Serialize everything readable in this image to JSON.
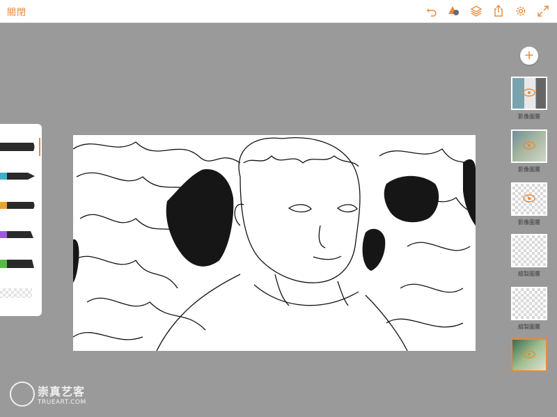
{
  "topbar": {
    "close_label": "關閉",
    "icons": [
      "undo-icon",
      "shapes-icon",
      "layers-icon",
      "share-icon",
      "settings-icon",
      "fullscreen-icon"
    ]
  },
  "brushes": [
    "brush-flat",
    "brush-teal-tip",
    "brush-orange",
    "brush-purple",
    "brush-green",
    "brush-texture"
  ],
  "layers": {
    "add_icon": "plus-icon",
    "items": [
      {
        "label": "影像圖層",
        "selected": false
      },
      {
        "label": "影像圖層",
        "selected": false
      },
      {
        "label": "影像圖層",
        "selected": false
      },
      {
        "label": "繪製圖層",
        "selected": false
      },
      {
        "label": "繪製圖層",
        "selected": false
      },
      {
        "label": "",
        "selected": true
      }
    ]
  },
  "watermark": {
    "cn": "崇真艺客",
    "en": "TRUEART.COM"
  },
  "colors": {
    "accent": "#e8893a",
    "background": "#9a9a9a",
    "panel": "#ffffff"
  }
}
